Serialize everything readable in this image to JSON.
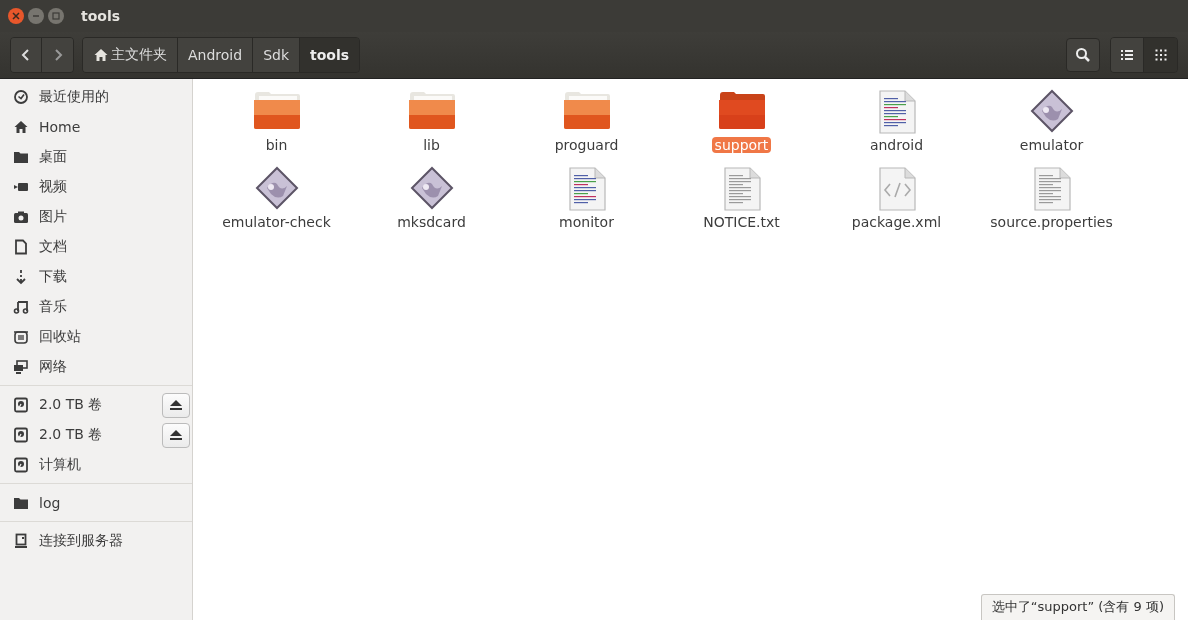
{
  "window": {
    "title": "tools"
  },
  "breadcrumbs": [
    {
      "label": "主文件夹",
      "kind": "home",
      "selected": false
    },
    {
      "label": "Android",
      "kind": "folder",
      "selected": false
    },
    {
      "label": "Sdk",
      "kind": "folder",
      "selected": false
    },
    {
      "label": "tools",
      "kind": "folder",
      "selected": true
    }
  ],
  "view_buttons": [
    {
      "kind": "list",
      "selected": false
    },
    {
      "kind": "grid",
      "selected": true
    }
  ],
  "sidebar": {
    "sections": [
      {
        "items": [
          {
            "label": "最近使用的",
            "kind": "recent"
          },
          {
            "label": "Home",
            "kind": "home"
          },
          {
            "label": "桌面",
            "kind": "folder"
          },
          {
            "label": "视频",
            "kind": "video"
          },
          {
            "label": "图片",
            "kind": "camera"
          },
          {
            "label": "文档",
            "kind": "document"
          },
          {
            "label": "下载",
            "kind": "download"
          },
          {
            "label": "音乐",
            "kind": "music"
          },
          {
            "label": "回收站",
            "kind": "trash"
          },
          {
            "label": "网络",
            "kind": "network"
          }
        ]
      },
      {
        "items": [
          {
            "label": "2.0 TB 卷",
            "kind": "drive",
            "ejectable": true
          },
          {
            "label": "2.0 TB 卷",
            "kind": "drive",
            "ejectable": true
          },
          {
            "label": "计算机",
            "kind": "drive",
            "ejectable": false
          }
        ]
      },
      {
        "items": [
          {
            "label": "log",
            "kind": "folder"
          }
        ]
      },
      {
        "items": [
          {
            "label": "连接到服务器",
            "kind": "server"
          }
        ]
      }
    ]
  },
  "files": [
    {
      "name": "bin",
      "kind": "folder",
      "selected": false
    },
    {
      "name": "lib",
      "kind": "folder",
      "selected": false
    },
    {
      "name": "proguard",
      "kind": "folder",
      "selected": false
    },
    {
      "name": "support",
      "kind": "folder",
      "selected": true
    },
    {
      "name": "android",
      "kind": "script",
      "selected": false
    },
    {
      "name": "emulator",
      "kind": "executable",
      "selected": false
    },
    {
      "name": "emulator-check",
      "kind": "executable",
      "selected": false
    },
    {
      "name": "mksdcard",
      "kind": "executable",
      "selected": false
    },
    {
      "name": "monitor",
      "kind": "script",
      "selected": false
    },
    {
      "name": "NOTICE.txt",
      "kind": "text",
      "selected": false
    },
    {
      "name": "package.xml",
      "kind": "xml",
      "selected": false
    },
    {
      "name": "source.properties",
      "kind": "text",
      "selected": false
    }
  ],
  "status_bar": {
    "text": "选中了“support” (含有 9 项)"
  }
}
